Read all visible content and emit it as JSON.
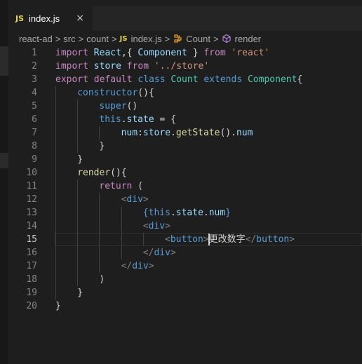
{
  "tab": {
    "badge": "JS",
    "label": "index.js",
    "close": "×"
  },
  "breadcrumb": {
    "items": [
      "react-ad",
      "src",
      "count",
      "index.js",
      "Count",
      "render"
    ],
    "js_badge": "JS",
    "sep": ">"
  },
  "colors": {
    "keyword": "#c586c0",
    "storage": "#569cd6",
    "class": "#4ec9b0",
    "string": "#ce9178",
    "variable": "#9cdcfe",
    "function": "#dcdcaa",
    "tag_bracket": "#808080",
    "tag": "#569cd6"
  },
  "editor": {
    "active_line": 15,
    "lines": [
      {
        "n": "1",
        "indent": 0,
        "tokens": [
          [
            "kw",
            "import"
          ],
          [
            "txt",
            " "
          ],
          [
            "var",
            "React"
          ],
          [
            "txt",
            ",{ "
          ],
          [
            "var",
            "Component"
          ],
          [
            "txt",
            " } "
          ],
          [
            "kw",
            "from"
          ],
          [
            "txt",
            " "
          ],
          [
            "str",
            "'react'"
          ]
        ]
      },
      {
        "n": "2",
        "indent": 0,
        "tokens": [
          [
            "kw",
            "import"
          ],
          [
            "txt",
            " "
          ],
          [
            "var",
            "store"
          ],
          [
            "txt",
            " "
          ],
          [
            "kw",
            "from"
          ],
          [
            "txt",
            " "
          ],
          [
            "str",
            "'../store'"
          ]
        ]
      },
      {
        "n": "3",
        "indent": 0,
        "tokens": [
          [
            "kw",
            "export"
          ],
          [
            "txt",
            " "
          ],
          [
            "kw",
            "default"
          ],
          [
            "txt",
            " "
          ],
          [
            "st",
            "class"
          ],
          [
            "txt",
            " "
          ],
          [
            "cls",
            "Count"
          ],
          [
            "txt",
            " "
          ],
          [
            "st",
            "extends"
          ],
          [
            "txt",
            " "
          ],
          [
            "cls",
            "Component"
          ],
          [
            "txt",
            "{"
          ]
        ]
      },
      {
        "n": "4",
        "indent": 1,
        "tokens": [
          [
            "st",
            "constructor"
          ],
          [
            "txt",
            "(){"
          ]
        ]
      },
      {
        "n": "5",
        "indent": 2,
        "tokens": [
          [
            "st",
            "super"
          ],
          [
            "txt",
            "()"
          ]
        ]
      },
      {
        "n": "6",
        "indent": 2,
        "tokens": [
          [
            "st",
            "this"
          ],
          [
            "txt",
            "."
          ],
          [
            "var",
            "state"
          ],
          [
            "txt",
            " = {"
          ]
        ]
      },
      {
        "n": "7",
        "indent": 3,
        "tokens": [
          [
            "var",
            "num"
          ],
          [
            "txt",
            ":"
          ],
          [
            "var",
            "store"
          ],
          [
            "txt",
            "."
          ],
          [
            "fn",
            "getState"
          ],
          [
            "txt",
            "()."
          ],
          [
            "var",
            "num"
          ]
        ]
      },
      {
        "n": "8",
        "indent": 2,
        "tokens": [
          [
            "txt",
            "}"
          ]
        ]
      },
      {
        "n": "9",
        "indent": 1,
        "tokens": [
          [
            "txt",
            "}"
          ]
        ]
      },
      {
        "n": "10",
        "indent": 1,
        "tokens": [
          [
            "fn",
            "render"
          ],
          [
            "txt",
            "(){"
          ]
        ]
      },
      {
        "n": "11",
        "indent": 2,
        "tokens": [
          [
            "kw",
            "return"
          ],
          [
            "txt",
            " ("
          ]
        ]
      },
      {
        "n": "12",
        "indent": 3,
        "tokens": [
          [
            "tagc",
            "<"
          ],
          [
            "tag",
            "div"
          ],
          [
            "tagc",
            ">"
          ]
        ]
      },
      {
        "n": "13",
        "indent": 4,
        "tokens": [
          [
            "st",
            "{"
          ],
          [
            "st",
            "this"
          ],
          [
            "txt",
            "."
          ],
          [
            "var",
            "state"
          ],
          [
            "txt",
            "."
          ],
          [
            "var",
            "num"
          ],
          [
            "st",
            "}"
          ]
        ]
      },
      {
        "n": "14",
        "indent": 4,
        "tokens": [
          [
            "tagc",
            "<"
          ],
          [
            "tag",
            "div"
          ],
          [
            "tagc",
            ">"
          ]
        ]
      },
      {
        "n": "15",
        "indent": 5,
        "tokens": [
          [
            "tagc",
            "<"
          ],
          [
            "tag",
            "button"
          ],
          [
            "tagc",
            ">"
          ],
          [
            "txt",
            "更改数字"
          ],
          [
            "tagc",
            "</"
          ],
          [
            "tag",
            "button"
          ],
          [
            "tagc",
            ">"
          ]
        ]
      },
      {
        "n": "16",
        "indent": 4,
        "tokens": [
          [
            "tagc",
            "</"
          ],
          [
            "tag",
            "div"
          ],
          [
            "tagc",
            ">"
          ]
        ]
      },
      {
        "n": "17",
        "indent": 3,
        "tokens": [
          [
            "tagc",
            "</"
          ],
          [
            "tag",
            "div"
          ],
          [
            "tagc",
            ">"
          ]
        ]
      },
      {
        "n": "18",
        "indent": 2,
        "tokens": [
          [
            "txt",
            ")"
          ]
        ]
      },
      {
        "n": "19",
        "indent": 1,
        "tokens": [
          [
            "txt",
            "}"
          ]
        ]
      },
      {
        "n": "20",
        "indent": 0,
        "tokens": [
          [
            "txt",
            "}"
          ]
        ]
      }
    ]
  }
}
